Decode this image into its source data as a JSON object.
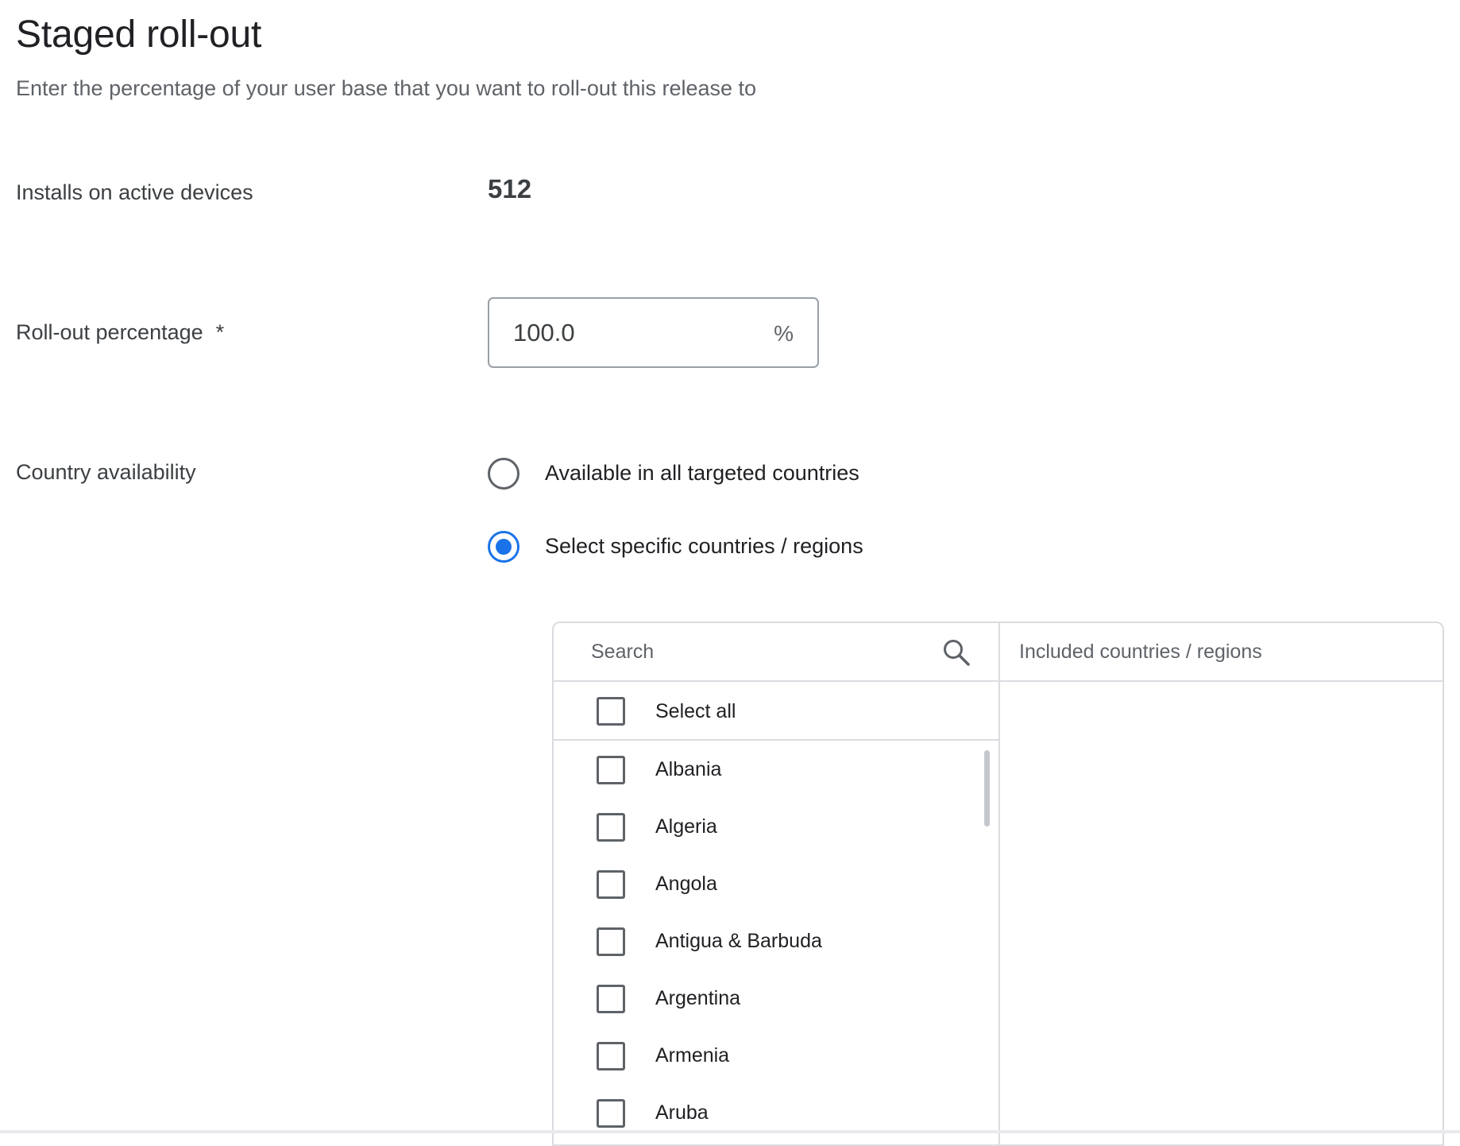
{
  "header": {
    "title": "Staged roll-out",
    "subtitle": "Enter the percentage of your user base that you want to roll-out this release to"
  },
  "installs": {
    "label": "Installs on active devices",
    "value": "512"
  },
  "rollout": {
    "label": "Roll-out percentage",
    "required_marker": "*",
    "value": "100.0",
    "suffix": "%"
  },
  "country_availability": {
    "label": "Country availability",
    "options": [
      {
        "label": "Available in all targeted countries",
        "checked": false
      },
      {
        "label": "Select specific countries / regions",
        "checked": true
      }
    ],
    "accent_color": "#1a73e8"
  },
  "picker": {
    "search_placeholder": "Search",
    "search_icon": "search-icon",
    "select_all_label": "Select all",
    "countries": [
      "Albania",
      "Algeria",
      "Angola",
      "Antigua & Barbuda",
      "Argentina",
      "Armenia",
      "Aruba"
    ],
    "included_title": "Included countries / regions"
  }
}
